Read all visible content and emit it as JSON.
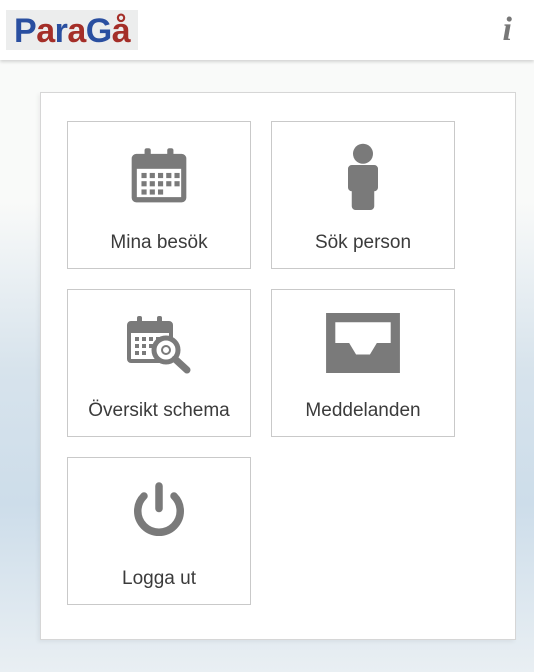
{
  "app": {
    "logo_letters": {
      "p": "P",
      "a1": "a",
      "r": "r",
      "a2": "a",
      "g": "G",
      "ao": "å"
    },
    "info_glyph": "i"
  },
  "menu": {
    "items": [
      {
        "key": "mina-besok",
        "label": "Mina besök"
      },
      {
        "key": "sok-person",
        "label": "Sök person"
      },
      {
        "key": "oversikt-schema",
        "label": "Översikt schema"
      },
      {
        "key": "meddelanden",
        "label": "Meddelanden"
      },
      {
        "key": "logga-ut",
        "label": "Logga ut"
      }
    ]
  },
  "colors": {
    "icon": "#7a7a7a",
    "logo_blue": "#2a4fa0",
    "logo_red": "#a42e28"
  }
}
